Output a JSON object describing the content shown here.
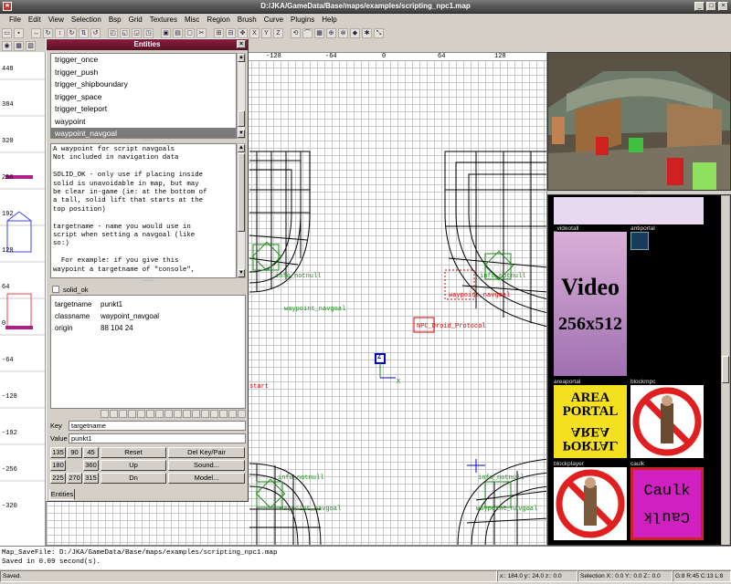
{
  "window": {
    "title": "D:/JKA/GameData/Base/maps/examples/scripting_npc1.map"
  },
  "menu": [
    "File",
    "Edit",
    "View",
    "Selection",
    "Bsp",
    "Grid",
    "Textures",
    "Misc",
    "Region",
    "Brush",
    "Curve",
    "Plugins",
    "Help"
  ],
  "left_ruler": [
    "448",
    "384",
    "320",
    "256",
    "192",
    "128",
    "64",
    "0",
    "-64",
    "-128",
    "-192",
    "-256",
    "-320"
  ],
  "top_ruler": [
    "-128",
    "-64",
    "0",
    "64",
    "128"
  ],
  "viewport_labels": {
    "info_notnull_1": "info_notnull",
    "info_notnull_2": "info_notnull",
    "waypoint_navgoal_1": "waypoint_navgoal",
    "waypoint_navgoal_2": "waypoint_navgoal",
    "npc": "NPC_Droid_Protocol",
    "start": "start",
    "info_notnull_3": "info_notnull",
    "waypoint_navgoal_3": "waypoint_navgoal",
    "info_notnull_4": "info_notnull",
    "waypoint_navgoal_4": "waypoint_navgoal",
    "z_marker": "Z",
    "x_axis": "X"
  },
  "entity_window": {
    "title": "Entities",
    "list": [
      "trigger_once",
      "trigger_push",
      "trigger_shipboundary",
      "trigger_space",
      "trigger_teleport",
      "waypoint",
      "waypoint_navgoal"
    ],
    "selected": "waypoint_navgoal",
    "description": "A waypoint for script navgoals\nNot included in navigation data\n\nSOLID_OK - only use if placing inside\nsolid is unavoidable in map, but may\nbe clear in-game (ie: at the bottom of\na tall, solid lift that starts at the\ntop position)\n\ntargetname - name you would use in\nscript when setting a navgoal (like\nso:)\n\n  For example: if you give this\nwaypoint a targetname of \"console\",",
    "checkbox_label": "solid_ok",
    "keyvalues": [
      {
        "key": "targetname",
        "value": "punkt1"
      },
      {
        "key": "classname",
        "value": "waypoint_navgoal"
      },
      {
        "key": "origin",
        "value": "88 104 24"
      }
    ],
    "key_label": "Key",
    "key_value": "targetname",
    "value_label": "Value",
    "value_value": "punkt1",
    "angle_buttons": [
      "135",
      "90",
      "45",
      "180",
      "",
      "360",
      "225",
      "270",
      "315"
    ],
    "action_buttons": {
      "reset": "Reset",
      "up": "Up",
      "dn": "Dn",
      "delkey": "Del Key/Pair",
      "sound": "Sound...",
      "model": "Model..."
    },
    "tab": "Entities"
  },
  "textures": {
    "names": [
      "_videotall",
      "antiportal",
      "areaportal",
      "blockmpc",
      "blockplayer",
      "caulk"
    ],
    "video_line1": "Video",
    "video_line2": "256x512",
    "area_line1": "AREA",
    "area_line2": "PORTAL",
    "caulk_text": "Caulk"
  },
  "console": {
    "lines": [
      "Map_SaveFile: D:/JKA/GameData/Base/maps/examples/scripting_npc1.map",
      "Saved in 0.09 second(s)."
    ]
  },
  "status": {
    "msg": "Saved.",
    "coords": "x:: 184.0  y:: 24.0  z:: 0.0",
    "selection": "Selection X:: 0.0  Y:: 0.0  Z:: 0.0",
    "grid": "G:8 R:45 C:13 L:8"
  },
  "colors": {
    "title_accent": "#8b1e3f",
    "selected": "#7b7b7b",
    "entity_green": "#1a8a1a",
    "entity_red": "#dd0000",
    "texture_border": "#cc2222"
  }
}
